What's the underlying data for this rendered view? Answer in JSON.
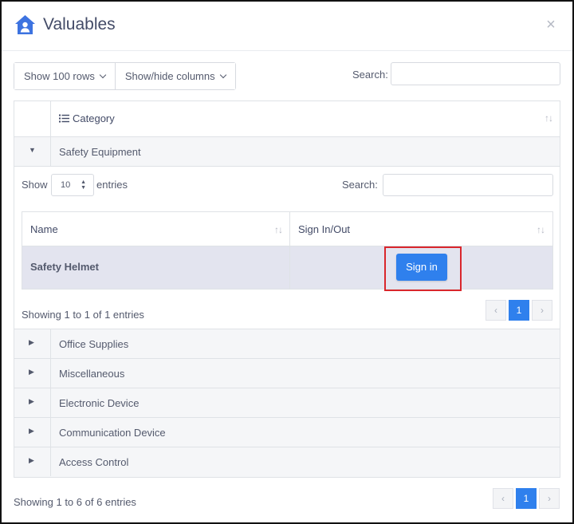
{
  "modal": {
    "title": "Valuables",
    "close_label": "×",
    "header_icon": "house-user-icon"
  },
  "toolbar": {
    "show_rows_label": "Show 100 rows",
    "show_hide_columns_label": "Show/hide columns",
    "search_label": "Search:",
    "search_value": ""
  },
  "table": {
    "category_header": "Category",
    "sort_icon": "↑↓",
    "groups": [
      {
        "label": "Safety Equipment",
        "expanded": true,
        "toggle": "▼"
      },
      {
        "label": "Office Supplies",
        "expanded": false,
        "toggle": "▶"
      },
      {
        "label": "Miscellaneous",
        "expanded": false,
        "toggle": "▶"
      },
      {
        "label": "Electronic Device",
        "expanded": false,
        "toggle": "▶"
      },
      {
        "label": "Communication Device",
        "expanded": false,
        "toggle": "▶"
      },
      {
        "label": "Access Control",
        "expanded": false,
        "toggle": "▶"
      }
    ]
  },
  "inner": {
    "show_label": "Show",
    "entries_value": "10",
    "entries_label": "entries",
    "search_label": "Search:",
    "columns": [
      "Name",
      "Sign In/Out"
    ],
    "rows": [
      {
        "name": "Safety Helmet",
        "action": "Sign in"
      }
    ],
    "showing": "Showing 1 to 1 of 1 entries",
    "pager": {
      "prev": "‹",
      "page": "1",
      "next": "›"
    }
  },
  "footer": {
    "showing": "Showing 1 to 6 of 6 entries",
    "pager": {
      "prev": "‹",
      "page": "1",
      "next": "›"
    }
  },
  "colors": {
    "accent": "#2f80ed",
    "highlight_border": "#d9262c",
    "selected_row": "#e3e4ef",
    "group_row": "#f5f6f8"
  }
}
